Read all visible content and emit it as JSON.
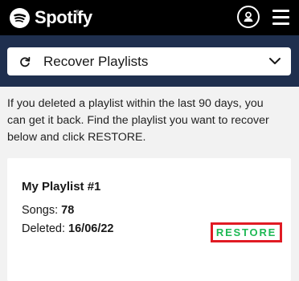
{
  "header": {
    "brand": "Spotify",
    "trademark": "®",
    "icons": [
      "spotify-logo-icon",
      "profile-icon",
      "hamburger-menu-icon"
    ],
    "background_color": "#000000"
  },
  "band": {
    "background_color": "#1f2f4e",
    "dropdown": {
      "icon": "refresh-icon",
      "label": "Recover Playlists",
      "chevron": "chevron-down-icon"
    }
  },
  "intro": {
    "lines": [
      "If you deleted a playlist within the last 90 days, you",
      "can get it back. Find the playlist you want to recover",
      "below and click RESTORE."
    ]
  },
  "playlist_card": {
    "title": "My Playlist #1",
    "songs_label": "Songs:",
    "songs_value": "78",
    "deleted_label": "Deleted:",
    "deleted_value": "16/06/22",
    "restore_label": "RESTORE",
    "restore_text_color": "#1db954",
    "highlight_color": "#e01b24"
  }
}
